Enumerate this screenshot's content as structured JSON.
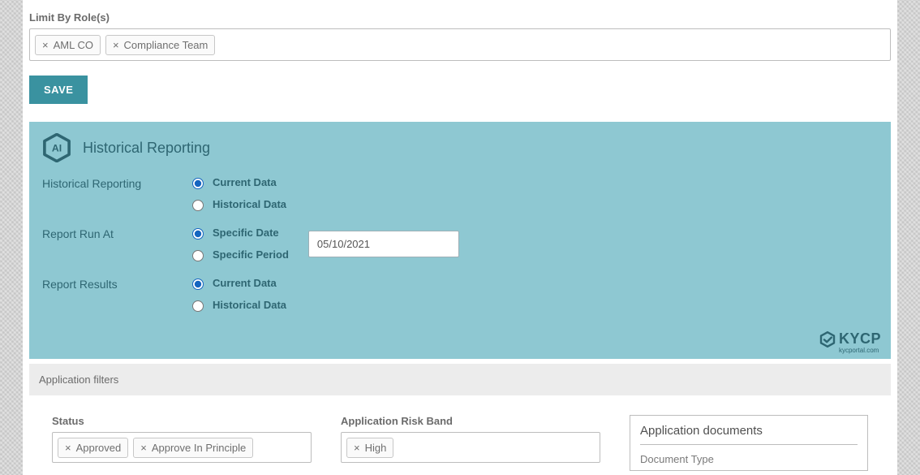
{
  "limitByRoles": {
    "label": "Limit By Role(s)",
    "tags": [
      "AML CO",
      "Compliance Team"
    ]
  },
  "saveLabel": "SAVE",
  "historical": {
    "title": "Historical Reporting",
    "rows": {
      "reporting": {
        "label": "Historical Reporting",
        "opt1": "Current Data",
        "opt2": "Historical Data"
      },
      "runAt": {
        "label": "Report Run At",
        "opt1": "Specific Date",
        "opt2": "Specific Period",
        "dateValue": "05/10/2021"
      },
      "results": {
        "label": "Report Results",
        "opt1": "Current Data",
        "opt2": "Historical Data"
      }
    },
    "brand": {
      "name": "KYCP",
      "sub": "kycportal.com"
    }
  },
  "appFilters": {
    "barLabel": "Application filters",
    "status": {
      "label": "Status",
      "tags": [
        "Approved",
        "Approve In Principle"
      ]
    },
    "riskBand": {
      "label": "Application Risk Band",
      "tags": [
        "High"
      ]
    },
    "documents": {
      "title": "Application documents",
      "sub": "Document Type"
    }
  }
}
